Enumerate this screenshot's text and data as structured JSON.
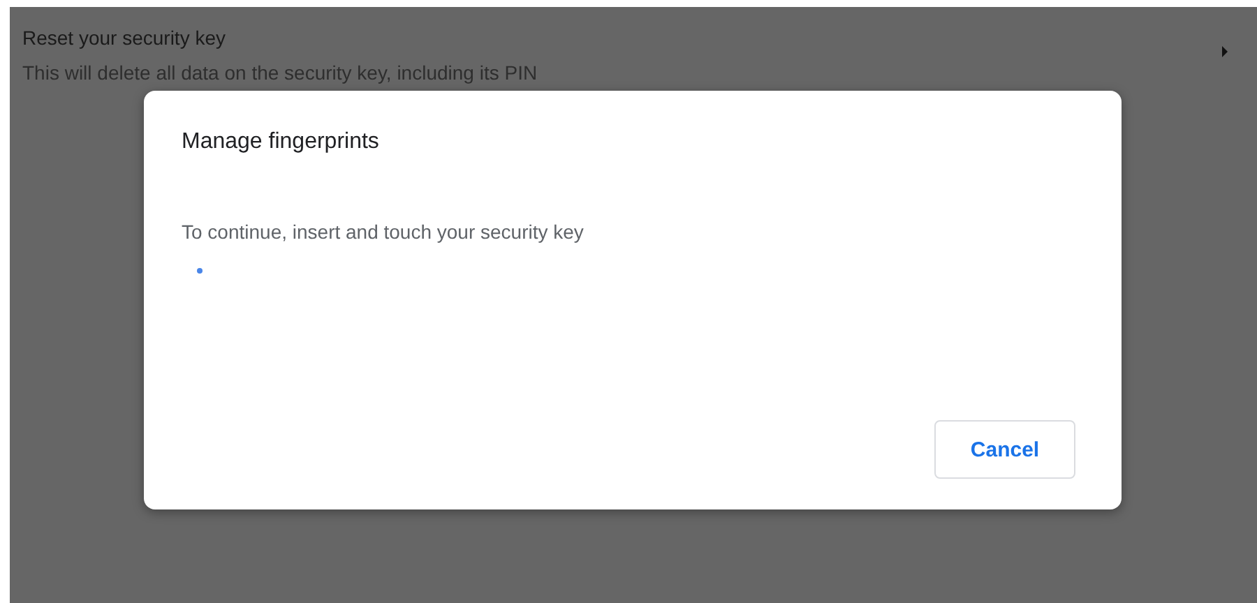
{
  "settings_row": {
    "title": "Reset your security key",
    "description": "This will delete all data on the security key, including its PIN"
  },
  "dialog": {
    "title": "Manage fingerprints",
    "message": "To continue, insert and touch your security key",
    "buttons": [
      "Cancel"
    ]
  }
}
